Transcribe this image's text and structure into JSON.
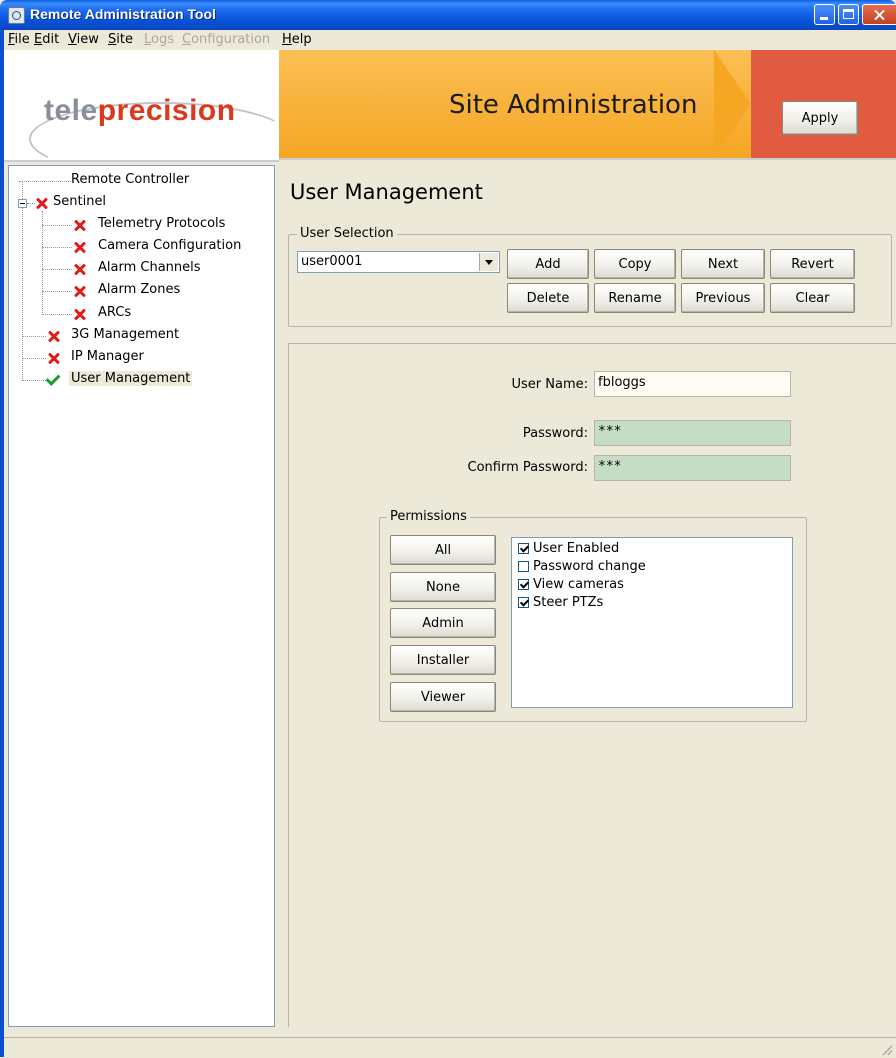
{
  "window": {
    "title": "Remote Administration Tool"
  },
  "menu": [
    {
      "label": "File",
      "hotkey": "F",
      "rest": "ile",
      "enabled": true
    },
    {
      "label": "Edit",
      "hotkey": "E",
      "rest": "dit",
      "enabled": true
    },
    {
      "label": "View",
      "hotkey": "V",
      "rest": "iew",
      "enabled": true
    },
    {
      "label": "Site",
      "hotkey": "S",
      "rest": "ite",
      "enabled": true
    },
    {
      "label": "Logs",
      "hotkey": "L",
      "rest": "ogs",
      "enabled": false
    },
    {
      "label": "Configuration",
      "hotkey": "C",
      "rest": "onfiguration",
      "enabled": false
    },
    {
      "label": "Help",
      "hotkey": "H",
      "rest": "elp",
      "enabled": true
    }
  ],
  "header": {
    "logo_part1": "tele",
    "logo_part2": "precision",
    "banner_title": "Site Administration",
    "apply_label": "Apply",
    "colors": {
      "banner": "#f5a623",
      "accent": "#e05b3f",
      "logo_red": "#d9391d"
    }
  },
  "tree": {
    "items": [
      {
        "label": "Remote Controller",
        "status": "none"
      },
      {
        "label": "Sentinel",
        "status": "error",
        "expanded": true
      },
      {
        "label": "Telemetry Protocols",
        "status": "error"
      },
      {
        "label": "Camera Configuration",
        "status": "error"
      },
      {
        "label": "Alarm Channels",
        "status": "error"
      },
      {
        "label": "Alarm Zones",
        "status": "error"
      },
      {
        "label": "ARCs",
        "status": "error"
      },
      {
        "label": "3G Management",
        "status": "error"
      },
      {
        "label": "IP Manager",
        "status": "error"
      },
      {
        "label": "User Management",
        "status": "ok",
        "selected": true
      }
    ]
  },
  "main": {
    "title": "User Management",
    "user_selection": {
      "legend": "User Selection",
      "selected_user": "user0001",
      "buttons": {
        "add": "Add",
        "copy": "Copy",
        "next": "Next",
        "revert": "Revert",
        "delete": "Delete",
        "rename": "Rename",
        "previous": "Previous",
        "clear": "Clear"
      }
    },
    "form": {
      "username_label": "User Name:",
      "username_value": "fbloggs",
      "password_label": "Password:",
      "password_value": "***",
      "confirm_label": "Confirm Password:",
      "confirm_value": "***"
    },
    "permissions": {
      "legend": "Permissions",
      "preset_buttons": [
        "All",
        "None",
        "Admin",
        "Installer",
        "Viewer"
      ],
      "items": [
        {
          "label": "User Enabled",
          "checked": true
        },
        {
          "label": "Password change",
          "checked": false
        },
        {
          "label": "View cameras",
          "checked": true
        },
        {
          "label": "Steer PTZs",
          "checked": true
        }
      ]
    }
  }
}
